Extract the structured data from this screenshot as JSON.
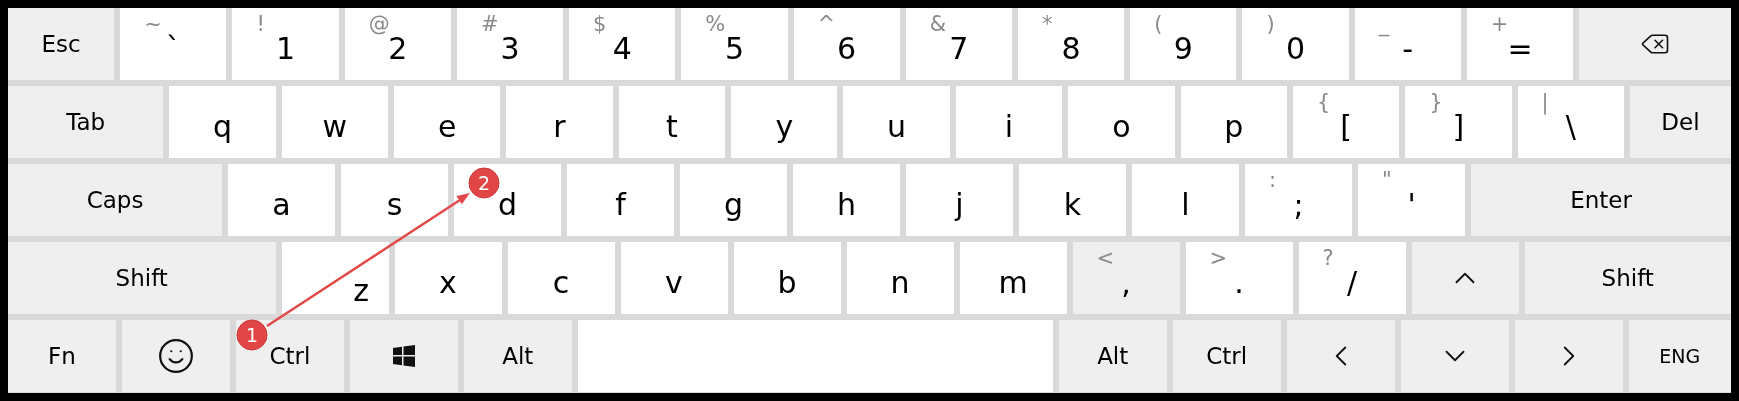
{
  "rows": [
    {
      "keys": [
        {
          "kind": "special",
          "label": "Esc"
        },
        {
          "kind": "char",
          "shift": "~",
          "label": "`"
        },
        {
          "kind": "char",
          "shift": "!",
          "label": "1"
        },
        {
          "kind": "char",
          "shift": "@",
          "label": "2"
        },
        {
          "kind": "char",
          "shift": "#",
          "label": "3"
        },
        {
          "kind": "char",
          "shift": "$",
          "label": "4"
        },
        {
          "kind": "char",
          "shift": "%",
          "label": "5"
        },
        {
          "kind": "char",
          "shift": "^",
          "label": "6"
        },
        {
          "kind": "char",
          "shift": "&",
          "label": "7"
        },
        {
          "kind": "char",
          "shift": "*",
          "label": "8"
        },
        {
          "kind": "char",
          "shift": "(",
          "label": "9"
        },
        {
          "kind": "char",
          "shift": ")",
          "label": "0"
        },
        {
          "kind": "char",
          "shift": "_",
          "label": "-"
        },
        {
          "kind": "char",
          "shift": "+",
          "label": "="
        },
        {
          "kind": "backspace"
        }
      ]
    },
    {
      "keys": [
        {
          "kind": "special",
          "label": "Tab"
        },
        {
          "kind": "char",
          "label": "q"
        },
        {
          "kind": "char",
          "label": "w"
        },
        {
          "kind": "char",
          "label": "e"
        },
        {
          "kind": "char",
          "label": "r"
        },
        {
          "kind": "char",
          "label": "t"
        },
        {
          "kind": "char",
          "label": "y"
        },
        {
          "kind": "char",
          "label": "u"
        },
        {
          "kind": "char",
          "label": "i"
        },
        {
          "kind": "char",
          "label": "o"
        },
        {
          "kind": "char",
          "label": "p"
        },
        {
          "kind": "char",
          "shift": "{",
          "label": "["
        },
        {
          "kind": "char",
          "shift": "}",
          "label": "]"
        },
        {
          "kind": "char",
          "shift": "|",
          "label": "\\"
        },
        {
          "kind": "special",
          "label": "Del"
        }
      ]
    },
    {
      "keys": [
        {
          "kind": "special",
          "label": "Caps"
        },
        {
          "kind": "char",
          "label": "a"
        },
        {
          "kind": "char",
          "label": "s"
        },
        {
          "kind": "char",
          "label": "d"
        },
        {
          "kind": "char",
          "label": "f"
        },
        {
          "kind": "char",
          "label": "g"
        },
        {
          "kind": "char",
          "label": "h"
        },
        {
          "kind": "char",
          "label": "j"
        },
        {
          "kind": "char",
          "label": "k"
        },
        {
          "kind": "char",
          "label": "l"
        },
        {
          "kind": "char",
          "shift": ":",
          "label": ";"
        },
        {
          "kind": "char",
          "shift": "\"",
          "label": "'"
        },
        {
          "kind": "special",
          "label": "Enter"
        }
      ]
    },
    {
      "keys": [
        {
          "kind": "special",
          "label": "Shift"
        },
        {
          "kind": "char",
          "label": "z"
        },
        {
          "kind": "char",
          "label": "x"
        },
        {
          "kind": "char",
          "label": "c"
        },
        {
          "kind": "char",
          "label": "v"
        },
        {
          "kind": "char",
          "label": "b"
        },
        {
          "kind": "char",
          "label": "n"
        },
        {
          "kind": "char",
          "label": "m"
        },
        {
          "kind": "shaded",
          "shift": "<",
          "label": ","
        },
        {
          "kind": "char",
          "shift": ">",
          "label": "."
        },
        {
          "kind": "char",
          "shift": "?",
          "label": "/"
        },
        {
          "kind": "up"
        },
        {
          "kind": "special",
          "label": "Shift"
        }
      ]
    },
    {
      "keys": [
        {
          "kind": "special",
          "label": "Fn"
        },
        {
          "kind": "emoji"
        },
        {
          "kind": "special",
          "label": "Ctrl"
        },
        {
          "kind": "windows"
        },
        {
          "kind": "special",
          "label": "Alt"
        },
        {
          "kind": "space"
        },
        {
          "kind": "special",
          "label": "Alt"
        },
        {
          "kind": "special",
          "label": "Ctrl"
        },
        {
          "kind": "left"
        },
        {
          "kind": "down"
        },
        {
          "kind": "right"
        },
        {
          "kind": "lang",
          "label": "ENG"
        }
      ]
    }
  ],
  "annotations": [
    {
      "label": "1"
    },
    {
      "label": "2"
    }
  ]
}
